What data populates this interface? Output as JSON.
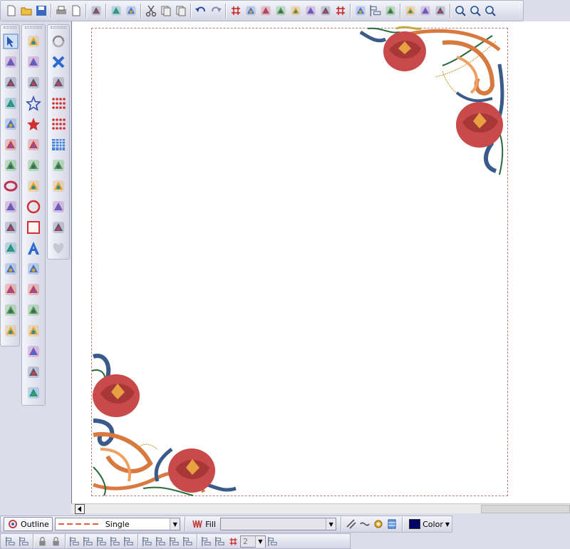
{
  "top_toolbar": {
    "groups": [
      [
        "new-icon",
        "open-icon",
        "save-icon"
      ],
      [
        "print-icon",
        "print-preview-icon"
      ],
      [
        "screen-icon"
      ],
      [
        "import-icon",
        "export-icon"
      ],
      [
        "cut-icon",
        "copy-icon",
        "paste-icon"
      ],
      [
        "undo-icon",
        "redo-icon"
      ],
      [
        "grid-icon",
        "hoop-icon",
        "flower-icon",
        "stitch-icon",
        "color-icon",
        "hatch-icon",
        "needle-icon",
        "stitch-grid-icon"
      ],
      [
        "layers-icon",
        "align-center-icon",
        "sequence-icon"
      ],
      [
        "slide-show-icon",
        "pin-icon",
        "pinwheel-icon"
      ],
      [
        "zoom-in-icon",
        "zoom-1to1-icon",
        "zoom-fit-icon"
      ]
    ]
  },
  "left_toolbar_1": [
    "select-icon",
    "wand-icon",
    "node-edit-icon",
    "triangle-fill-icon",
    "arrow-shape-icon",
    "curve-icon",
    "square-gray-icon",
    "ring-icon",
    "stand-icon",
    "triangle-outline-icon",
    "triangle-gray-icon",
    "cluster-icon",
    "square-gradient-icon",
    "gears-icon",
    "multi-color-icon"
  ],
  "left_toolbar_2": [
    "swirl-icon",
    "feather-icon",
    "bug-icon",
    "star-outline-icon",
    "star-red-icon",
    "wave-line-icon",
    "zigzag-icon",
    "ladder-icon",
    "circle-red-icon",
    "square-red-icon",
    "letter-a-icon",
    "monogram-icon",
    "flower-badge-icon",
    "fish-icon",
    "hand-icon",
    "frame-icon",
    "cross-stitch-icon",
    "dots-card-icon"
  ],
  "left_toolbar_3": [
    "cycle-icon",
    "cross-blue-icon",
    "gear-blue-icon",
    "dots-red-icon",
    "dots-red-2-icon",
    "calendar-grid-icon",
    "lace-icon",
    "leaf-icon",
    "needle-thread-icon",
    "gray-circle-icon",
    "heart-icon"
  ],
  "property_bar": {
    "outline_label": "Outline",
    "line_style": "Single",
    "fill_label": "Fill",
    "fill_value": "",
    "color_label": "Color",
    "color_swatch": "#000066",
    "line_color": "#e06040"
  },
  "align_bar": {
    "icons": [
      "align-left-icon",
      "align-icon-2",
      "lock-icon",
      "unlock-icon",
      "align-top-icon",
      "align-middle-icon",
      "align-bottom-icon",
      "distribute-icon",
      "align-v-icon",
      "align-h-icon",
      "center-icon",
      "space-v-icon",
      "space-h-icon",
      "rotate-icon",
      "flip-icon",
      "grid-spacing-icon",
      "spacing-icon"
    ],
    "spin_value": "2"
  },
  "design": {
    "hoop_color": "#b47b78",
    "rose_color": "#c84a4a",
    "leaf_color": "#2a6a3a",
    "swirl_blue": "#3a5a8a",
    "swirl_orange": "#d87a40",
    "gold": "#c8a640"
  }
}
